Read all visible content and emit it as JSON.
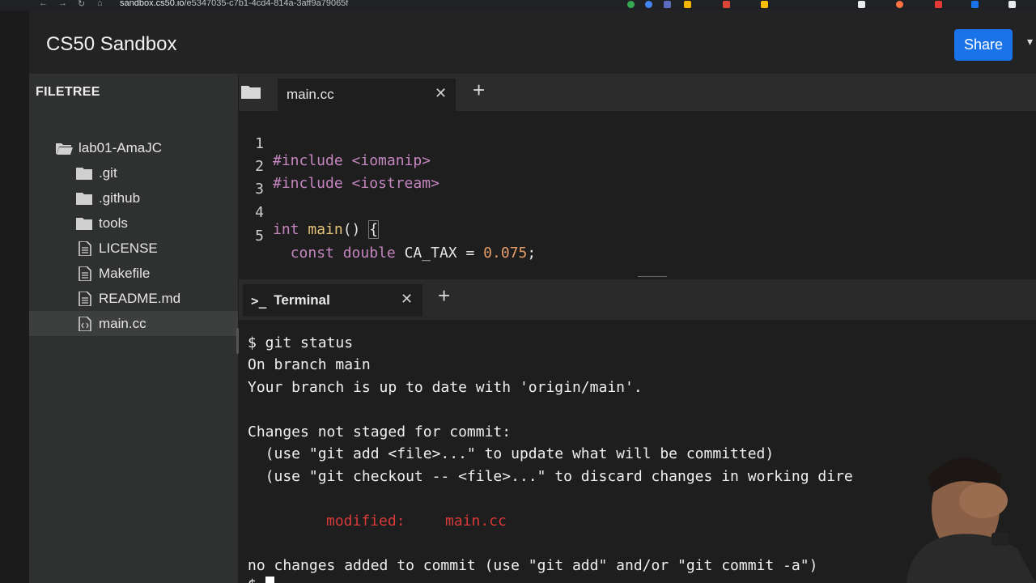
{
  "browser": {
    "url_host": "sandbox.cs50.io",
    "url_path": "/e5347035-c7b1-4cd4-814a-3aff9a79065f"
  },
  "header": {
    "title": "CS50 Sandbox",
    "share_label": "Share"
  },
  "sidebar": {
    "label": "FILETREE",
    "items": [
      {
        "label": "lab01-AmaJC",
        "icon": "folder-open-icon"
      },
      {
        "label": ".git",
        "icon": "folder-icon"
      },
      {
        "label": ".github",
        "icon": "folder-icon"
      },
      {
        "label": "tools",
        "icon": "folder-icon"
      },
      {
        "label": "LICENSE",
        "icon": "file-icon"
      },
      {
        "label": "Makefile",
        "icon": "file-icon"
      },
      {
        "label": "README.md",
        "icon": "file-icon"
      },
      {
        "label": "main.cc",
        "icon": "code-file-icon"
      }
    ]
  },
  "editor": {
    "tab_label": "main.cc",
    "lines": [
      {
        "n": "1",
        "a": "#include",
        "b": " <iomanip>"
      },
      {
        "n": "2",
        "a": "#include",
        "b": " <iostream>"
      },
      {
        "n": "3"
      },
      {
        "n": "4",
        "type": "int",
        "fn": "main",
        "rest": "()",
        "brace": "{"
      },
      {
        "n": "5",
        "k1": "const",
        "k2": "double",
        "ident": "CA_TAX",
        "eq": " = ",
        "num": "0.075",
        "semi": ";"
      }
    ]
  },
  "terminal": {
    "tab_label": "Terminal",
    "lines": [
      "$ git status",
      "On branch main",
      "Your branch is up to date with 'origin/main'.",
      "",
      "Changes not staged for commit:",
      "  (use \"git add <file>...\" to update what will be committed)",
      "  (use \"git checkout -- <file>...\" to discard changes in working dire"
    ],
    "modified_label": "modified:",
    "modified_file": "main.cc",
    "final_line": "no changes added to commit (use \"git add\" and/or \"git commit -a\")",
    "prompt": "$ "
  },
  "colors": {
    "share_button": "#1a73e8",
    "sidebar_bg": "#2f3030",
    "keyword": "#c586c0",
    "function": "#e5c07b",
    "number": "#e59d6a",
    "modified": "#d83a3a"
  }
}
